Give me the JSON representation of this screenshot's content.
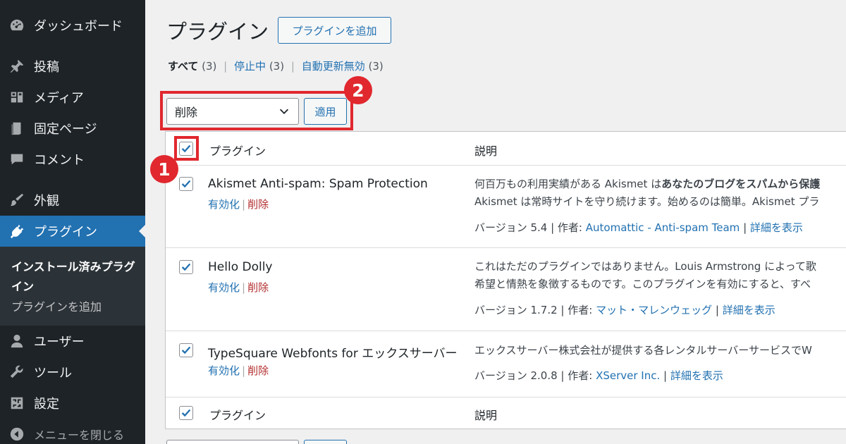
{
  "sidebar": {
    "items": [
      {
        "label": "ダッシュボード",
        "icon": "dashboard-icon"
      },
      {
        "label": "投稿",
        "icon": "pin-icon"
      },
      {
        "label": "メディア",
        "icon": "media-icon"
      },
      {
        "label": "固定ページ",
        "icon": "page-icon"
      },
      {
        "label": "コメント",
        "icon": "comment-icon"
      },
      {
        "label": "外観",
        "icon": "appearance-icon"
      },
      {
        "label": "プラグイン",
        "icon": "plugin-icon"
      },
      {
        "label": "ユーザー",
        "icon": "user-icon"
      },
      {
        "label": "ツール",
        "icon": "wrench-icon"
      },
      {
        "label": "設定",
        "icon": "settings-icon"
      },
      {
        "label": "メニューを閉じる",
        "icon": "collapse-icon"
      }
    ],
    "submenu": {
      "current": "インストール済みプラグイン",
      "add": "プラグインを追加"
    }
  },
  "header": {
    "title": "プラグイン",
    "add_button": "プラグインを追加"
  },
  "filters": {
    "all": "すべて",
    "all_count": "(3)",
    "inactive": "停止中",
    "inactive_count": "(3)",
    "autoupdate_disabled": "自動更新無効",
    "autoupdate_count": "(3)",
    "separator": "|"
  },
  "bulk": {
    "selected": "削除",
    "apply": "適用"
  },
  "annotations": {
    "one": "1",
    "two": "2",
    "color": "#e0282e"
  },
  "table": {
    "col_plugin": "プラグイン",
    "col_desc": "説明",
    "rows": [
      {
        "name": "Akismet Anti-spam: Spam Protection",
        "activate": "有効化",
        "delete": "削除",
        "desc_line1_a": "何百万もの利用実績がある Akismet は",
        "desc_line1_b": "あなたのブログをスパムから保護",
        "desc_line2": "Akismet は常時サイトを守り続けます。始めるのは簡単。Akismet プラ",
        "version": "バージョン 5.4 | 作者: ",
        "author": "Automattic - Anti-spam Team",
        "details": "詳細を表示"
      },
      {
        "name": "Hello Dolly",
        "activate": "有効化",
        "delete": "削除",
        "desc_line1_a": "これはただのプラグインではありません。Louis Armstrong によって歌",
        "desc_line1_b": "",
        "desc_line2": "希望と情熱を象徴するものです。このプラグインを有効にすると、すべ",
        "version": "バージョン 1.7.2 | 作者: ",
        "author": "マット・マレンウェッグ",
        "details": "詳細を表示"
      },
      {
        "name": "TypeSquare Webfonts for エックスサーバー",
        "activate": "有効化",
        "delete": "削除",
        "desc_line1_a": "エックスサーバー株式会社が提供する各レンタルサーバーサービスでW",
        "desc_line1_b": "",
        "desc_line2": "",
        "version": "バージョン 2.0.8 | 作者: ",
        "author": "XServer Inc.",
        "details": "詳細を表示"
      }
    ]
  },
  "colors": {
    "sidebar_bg": "#1d2327",
    "accent": "#2271b1",
    "delete": "#b32d2e"
  }
}
